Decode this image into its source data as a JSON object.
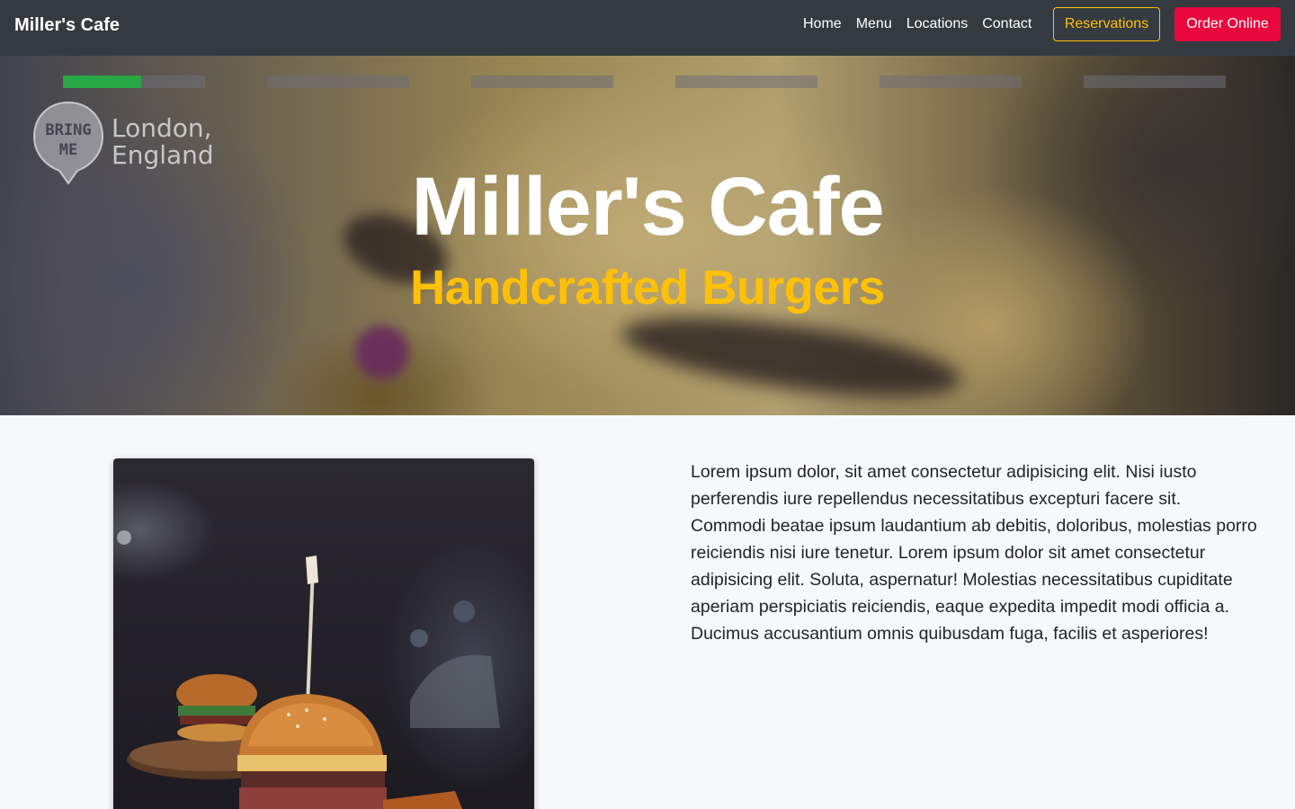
{
  "navbar": {
    "brand": "Miller's Cafe",
    "links": [
      {
        "label": "Home"
      },
      {
        "label": "Menu"
      },
      {
        "label": "Locations"
      },
      {
        "label": "Contact"
      }
    ],
    "reservations_label": "Reservations",
    "order_label": "Order Online"
  },
  "hero": {
    "title": "Miller's Cafe",
    "subtitle": "Handcrafted Burgers",
    "carousel": {
      "slides": 6,
      "active_slide": 1,
      "active_progress_fraction": 0.55
    },
    "watermark": {
      "badge_line1": "BRING",
      "badge_line2": "ME",
      "location_line1": "London,",
      "location_line2": "England"
    }
  },
  "content": {
    "paragraph": "Lorem ipsum dolor, sit amet consectetur adipisicing elit. Nisi iusto perferendis iure repellendus necessitatibus excepturi facere sit. Commodi beatae ipsum laudantium ab debitis, doloribus, molestias porro reiciendis nisi iure tenetur. Lorem ipsum dolor sit amet consectetur adipisicing elit. Soluta, aspernatur! Molestias necessitatibus cupiditate aperiam perspiciatis reiciendis, eaque expedita impedit modi officia a. Ducimus accusantium omnis quibusdam fuga, facilis et asperiores!"
  },
  "colors": {
    "navbar_bg": "#343a40",
    "accent_yellow": "#ffc107",
    "order_red": "#e8083e",
    "progress_green": "#28a745"
  }
}
